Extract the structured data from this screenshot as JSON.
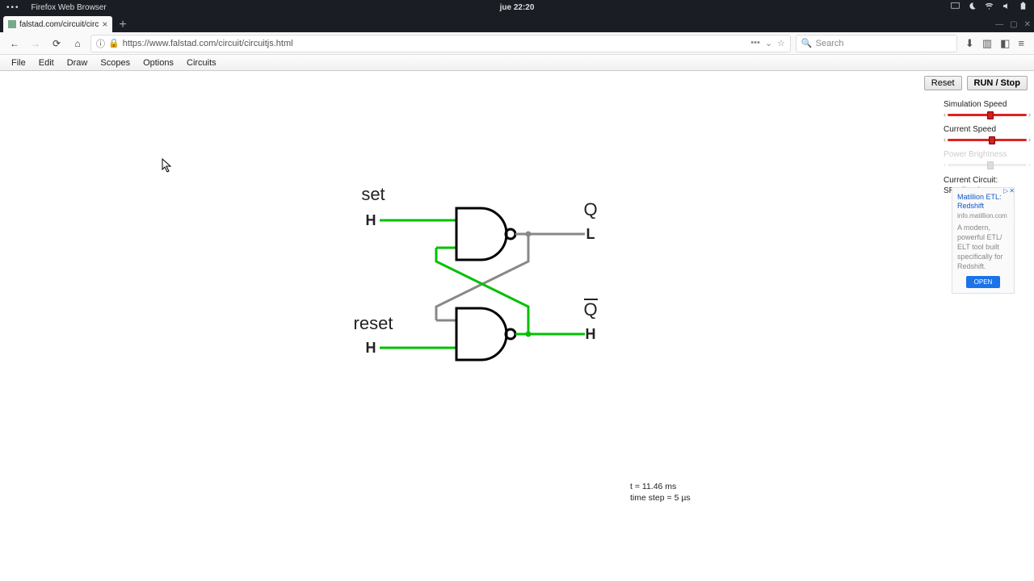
{
  "os": {
    "app_name": "Firefox Web Browser",
    "clock": "jue 22:20"
  },
  "tab": {
    "title": "falstad.com/circuit/circ"
  },
  "url": "https://www.falstad.com/circuit/circuitjs.html",
  "search_placeholder": "Search",
  "menu": {
    "file": "File",
    "edit": "Edit",
    "draw": "Draw",
    "scopes": "Scopes",
    "options": "Options",
    "circuits": "Circuits"
  },
  "buttons": {
    "reset": "Reset",
    "run": "RUN",
    "stop_suffix": " / Stop"
  },
  "sliders": {
    "sim": "Simulation Speed",
    "cur": "Current Speed",
    "pow": "Power Brightness"
  },
  "current_circuit_label": "Current Circuit:",
  "current_circuit_name": "SR Flip-Flop",
  "ad": {
    "title1": "Matillion ETL:",
    "title2": "Redshift",
    "url": "info.matillion.com",
    "body": "A modern, powerful ETL/ ELT tool built specifically for Redshift.",
    "cta": "OPEN"
  },
  "circuit": {
    "set_label": "set",
    "reset_label": "reset",
    "h1": "H",
    "h2": "H",
    "q": "Q",
    "ql": "L",
    "qbar": "Q",
    "qbar_val": "H"
  },
  "status": {
    "line1": "t = 11.46 ms",
    "line2": "time step = 5 µs"
  }
}
